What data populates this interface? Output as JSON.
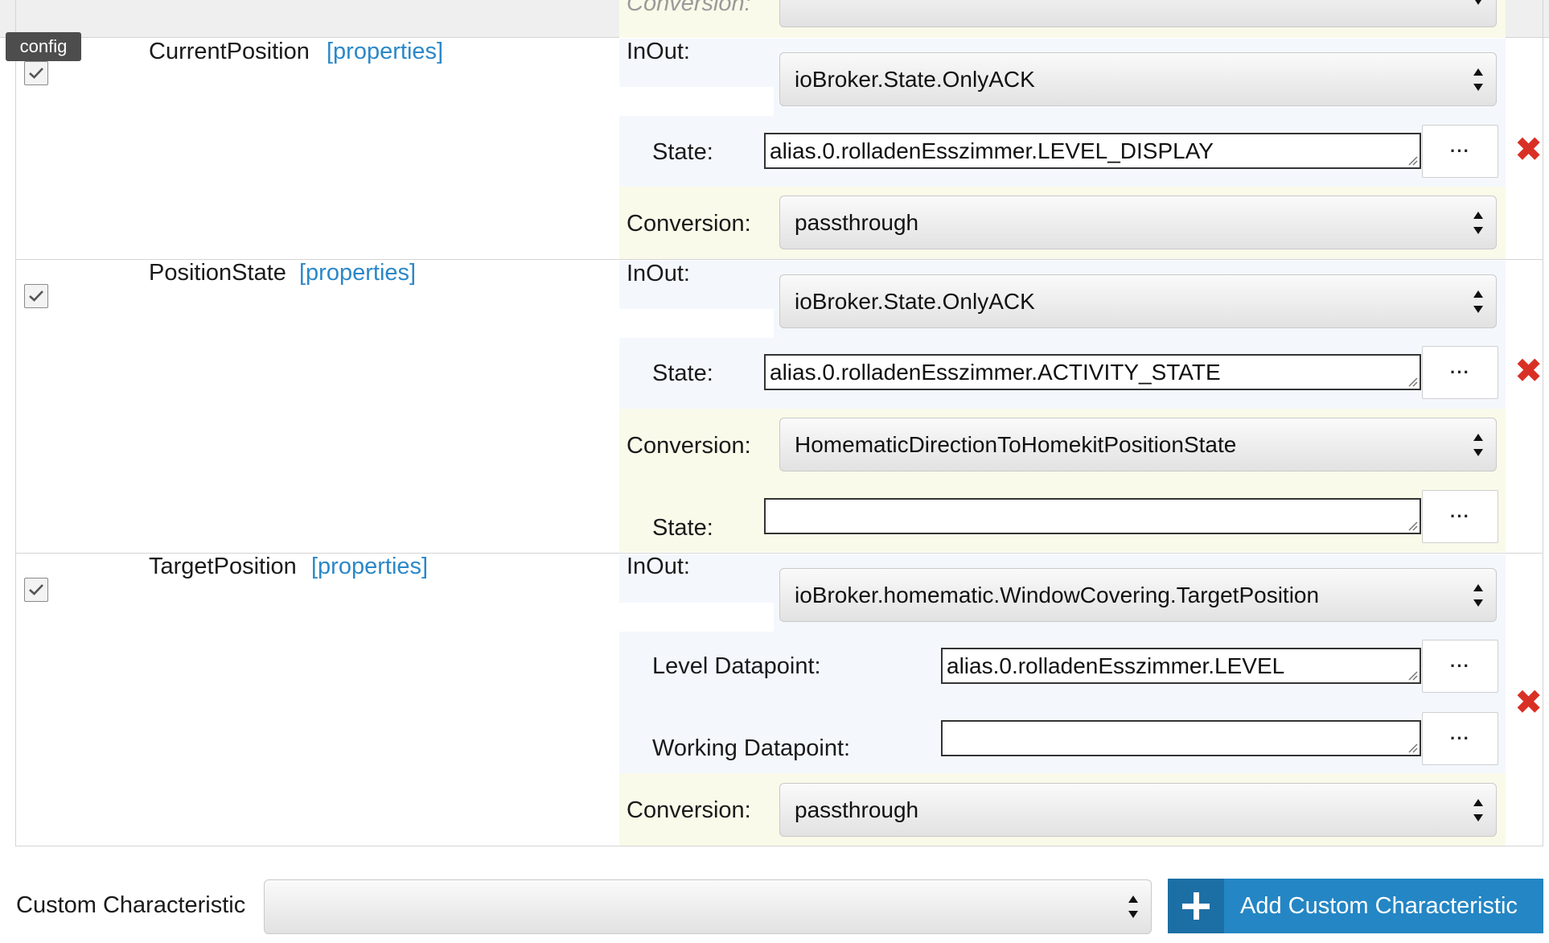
{
  "tooltip": {
    "text": "config"
  },
  "top_partial": {
    "conversion_label": "Conversion:"
  },
  "characteristics": [
    {
      "name": "CurrentPosition",
      "properties_link": "[properties]",
      "enabled": true,
      "inout_label": "InOut:",
      "inout_value": "ioBroker.State.OnlyACK",
      "state_label": "State:",
      "state_value": "alias.0.rolladenEsszimmer.LEVEL_DISPLAY",
      "conversion_label": "Conversion:",
      "conversion_value": "passthrough",
      "browse_label": "···"
    },
    {
      "name": "PositionState",
      "properties_link": "[properties]",
      "enabled": true,
      "inout_label": "InOut:",
      "inout_value": "ioBroker.State.OnlyACK",
      "state_label": "State:",
      "state_value": "alias.0.rolladenEsszimmer.ACTIVITY_STATE",
      "conversion_label": "Conversion:",
      "conversion_value": "HomematicDirectionToHomekitPositionState",
      "state2_label": "State:",
      "state2_value": "",
      "browse_label": "···"
    },
    {
      "name": "TargetPosition",
      "properties_link": "[properties]",
      "enabled": true,
      "inout_label": "InOut:",
      "inout_value": "ioBroker.homematic.WindowCovering.TargetPosition",
      "level_label": "Level Datapoint:",
      "level_value": "alias.0.rolladenEsszimmer.LEVEL",
      "working_label": "Working Datapoint:",
      "working_value": "",
      "conversion_label": "Conversion:",
      "conversion_value": "passthrough",
      "browse_label": "···"
    }
  ],
  "footer": {
    "custom_label": "Custom Characteristic",
    "custom_select_value": "",
    "add_button_label": "Add Custom Characteristic"
  },
  "colors": {
    "link": "#2b88c8",
    "delete": "#d93025",
    "button": "#2486c4",
    "button_icon_bg": "#1c6fa4",
    "inout_bg": "#f4f8fd",
    "conversion_bg": "#fafaea"
  },
  "icons": [
    "check-icon",
    "delete-x-icon",
    "plus-icon",
    "select-arrows-icon",
    "resize-grip-icon",
    "ellipsis-icon"
  ]
}
